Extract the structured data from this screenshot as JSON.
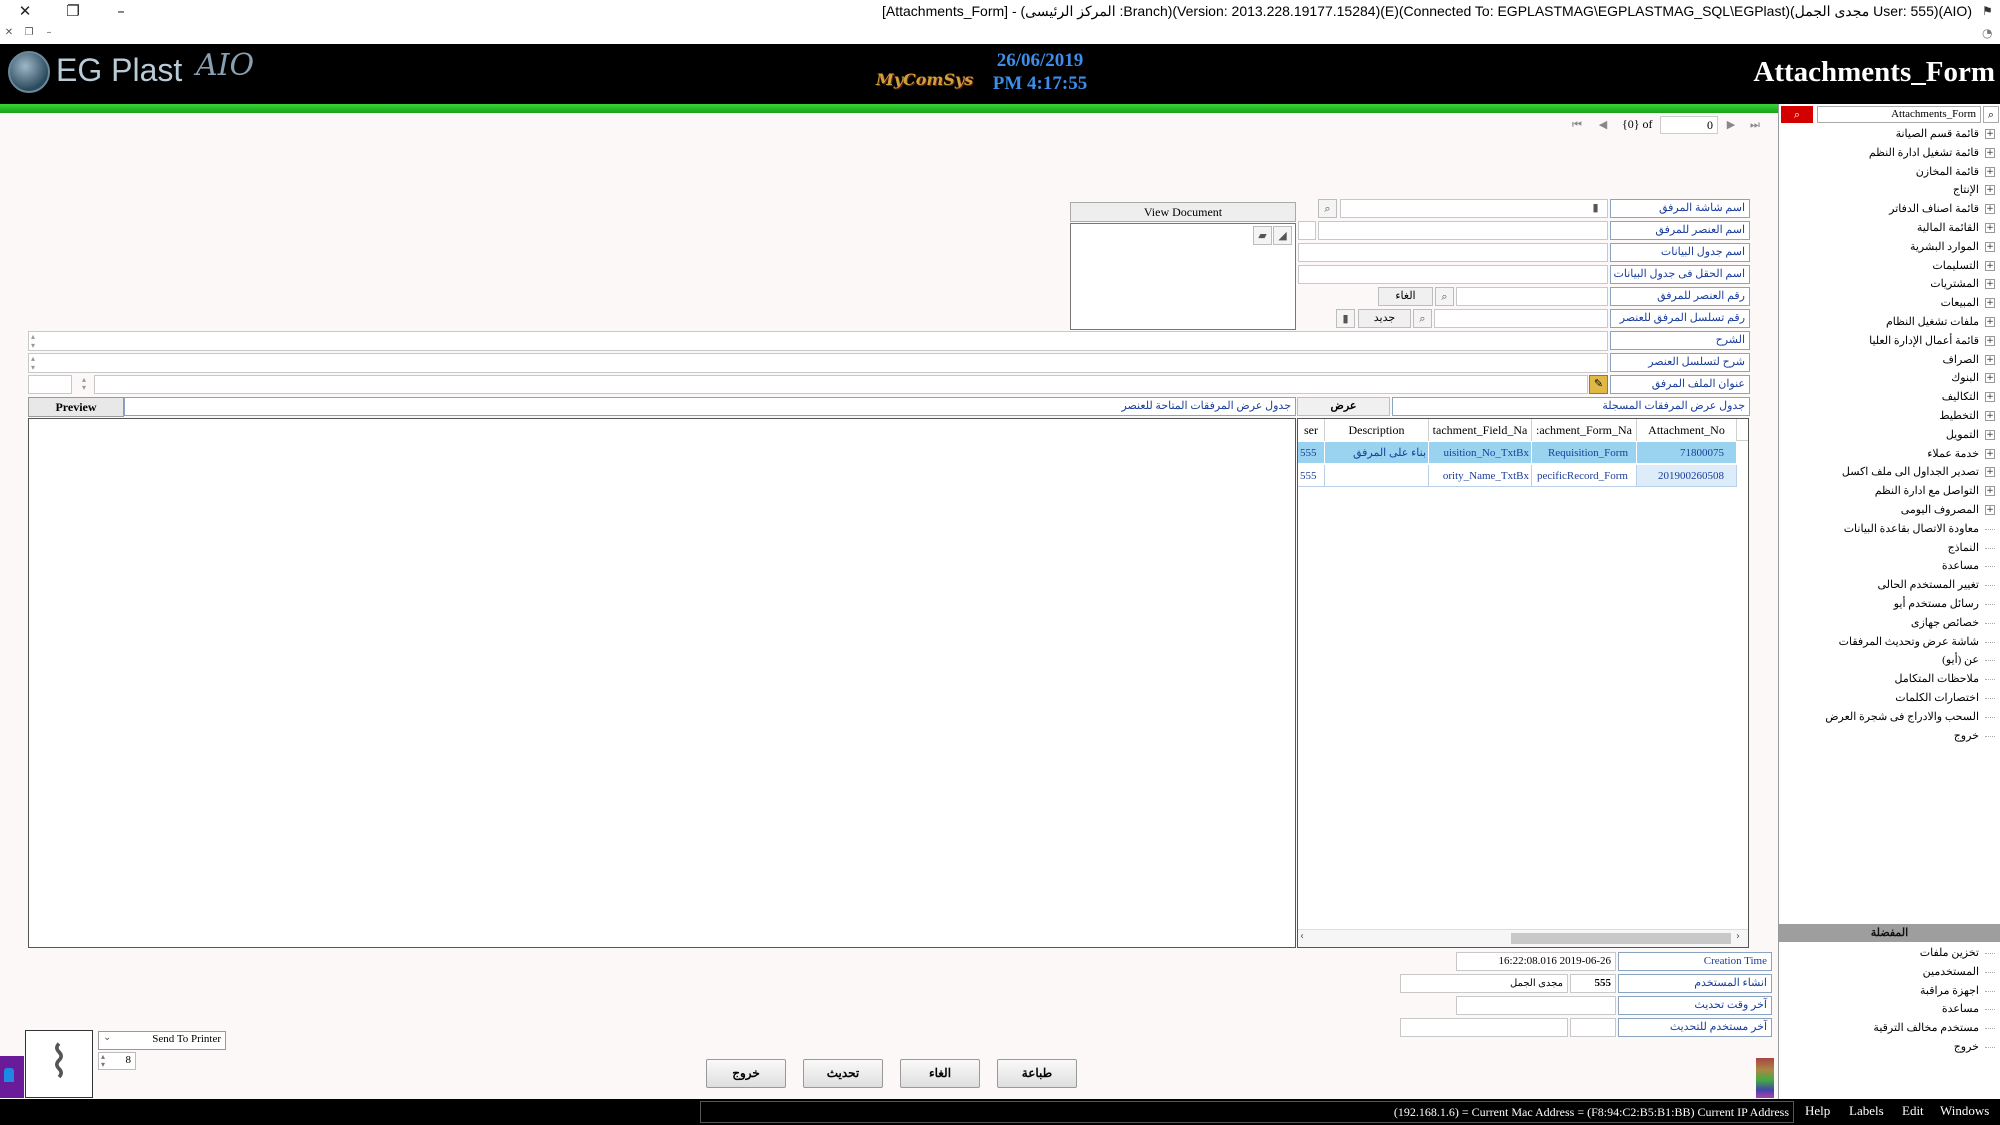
{
  "window": {
    "title": "[Attachments_Form] - (المركز الرئيسى :Branch)(Version: 2013.228.19177.15284)(E)(Connected To: EGPLASTMAG\\EGPLASTMAG_SQL\\EGPlast)(مجدى الجمل User: 555)(AIO)"
  },
  "banner": {
    "logo_text": "EG Plast",
    "logo_suffix": "AIO",
    "brand": "MyComSys",
    "date": "26/06/2019",
    "time": "PM 4:17:55",
    "form_title": "Attachments_Form"
  },
  "nav": {
    "position_text": "{0} of",
    "record_number": "0"
  },
  "form": {
    "labels": {
      "attachment_screen_name": "اسم شاشة المرفق",
      "element_name": "اسم العنصر للمرفق",
      "table_name": "اسم جدول البيانات",
      "field_name": "اسم الحقل فى جدول البيانات",
      "element_number": "رقم العنصر للمرفق",
      "element_sequence_number": "رقم تسلسل المرفق للعنصر",
      "explanation": "الشرح",
      "sequence_explanation": "شرح لتسلسل العنصر",
      "file_title": "عنوان الملف المرفق",
      "registered_table": "جدول عرض المرفقات المسجلة"
    },
    "cancel_label": "الغاء",
    "new_label": "جديد",
    "view_label": "عرض",
    "view_document_label": "View Document",
    "preview_label": "Preview",
    "available_attachments_label": "جدول عرض المرفقات المتاحة للعنصر",
    "file_spin_value": ""
  },
  "grid": {
    "columns": [
      "Attachment_No",
      "Attachment_Form_Name",
      "Attachment_Field_Name",
      "Description",
      "User"
    ],
    "header_display": [
      "Attachment_No",
      ":achment_Form_Na",
      "tachment_Field_Na",
      "Description",
      "ser"
    ],
    "rows": [
      {
        "no": "71800075",
        "form": "Requisition_Form",
        "field": "uisition_No_TxtBx",
        "desc": "بناء على المرفق",
        "user": "555",
        "selected": true
      },
      {
        "no": "201900260508",
        "form": "pecificRecord_Form",
        "field": "ority_Name_TxtBx",
        "desc": "",
        "user": "555",
        "selected": false
      }
    ]
  },
  "audit": {
    "creation_time_label": "Creation Time",
    "creation_time_value": "16:22:08.016 2019-06-26",
    "created_by_label": "انشاء المستخدم",
    "created_by_id": "555",
    "created_by_name": "مجدى الجمل",
    "last_update_time_label": "آخر وقت تحديث",
    "last_update_user_label": "آخر مستخدم للتحديث"
  },
  "printer": {
    "label": "Send To Printer",
    "copies": "8"
  },
  "buttons": {
    "print": "طباعة",
    "cancel": "الغاء",
    "update": "تحديث",
    "exit": "خروج"
  },
  "sidebar": {
    "search_value": "Attachments_Form",
    "tree": [
      {
        "label": "قائمة قسم الصيانة",
        "expandable": true
      },
      {
        "label": "قائمة تشغيل ادارة النظم",
        "expandable": true
      },
      {
        "label": "قائمة المخازن",
        "expandable": true
      },
      {
        "label": "الإنتاج",
        "expandable": true
      },
      {
        "label": "قائمة اصناف الدفاتر",
        "expandable": true
      },
      {
        "label": "القائمة المالية",
        "expandable": true
      },
      {
        "label": "الموارد البشرية",
        "expandable": true
      },
      {
        "label": "التسليمات",
        "expandable": true
      },
      {
        "label": "المشتريات",
        "expandable": true
      },
      {
        "label": "المبيعات",
        "expandable": true
      },
      {
        "label": "ملفات تشغيل النظام",
        "expandable": true
      },
      {
        "label": "قائمة أعمال الإدارة العليا",
        "expandable": true
      },
      {
        "label": "الصراف",
        "expandable": true
      },
      {
        "label": "البنوك",
        "expandable": true
      },
      {
        "label": "التكاليف",
        "expandable": true
      },
      {
        "label": "التخطيط",
        "expandable": true
      },
      {
        "label": "التمويل",
        "expandable": true
      },
      {
        "label": "خدمة عملاء",
        "expandable": true
      },
      {
        "label": "تصدير الجداول الى ملف اكسل",
        "expandable": true
      },
      {
        "label": "التواصل مع ادارة النظم",
        "expandable": true
      },
      {
        "label": "المصروف اليومى",
        "expandable": true
      },
      {
        "label": "معاودة الاتصال بقاعدة البيانات",
        "expandable": false
      },
      {
        "label": "النماذج",
        "expandable": false
      },
      {
        "label": "مساعدة",
        "expandable": false
      },
      {
        "label": "تغيير المستخدم الحالى",
        "expandable": false
      },
      {
        "label": "رسائل مستخدم أيو",
        "expandable": false
      },
      {
        "label": "خصائص جهازى",
        "expandable": false
      },
      {
        "label": "شاشة عرض وتحديث المرفقات",
        "expandable": false
      },
      {
        "label": "عن (أيو)",
        "expandable": false
      },
      {
        "label": "ملاحظات المتكامل",
        "expandable": false
      },
      {
        "label": "اختصارات الكلمات",
        "expandable": false
      },
      {
        "label": "السحب والادراج فى شجرة العرض",
        "expandable": false
      },
      {
        "label": "خروج",
        "expandable": false
      }
    ],
    "favorites_header": "المفضلة",
    "favorites": [
      "تخزين ملفات",
      "المستخدمين",
      "اجهزة مراقبة",
      "مساعدة",
      "مستخدم مخالف الترقية",
      "خروج"
    ]
  },
  "statusbar": {
    "text": "(192.168.1.6) = Current Mac Address = (F8:94:C2:B5:B1:BB) Current IP Address",
    "menus": [
      "Help",
      "Labels",
      "Edit",
      "Windows"
    ]
  }
}
